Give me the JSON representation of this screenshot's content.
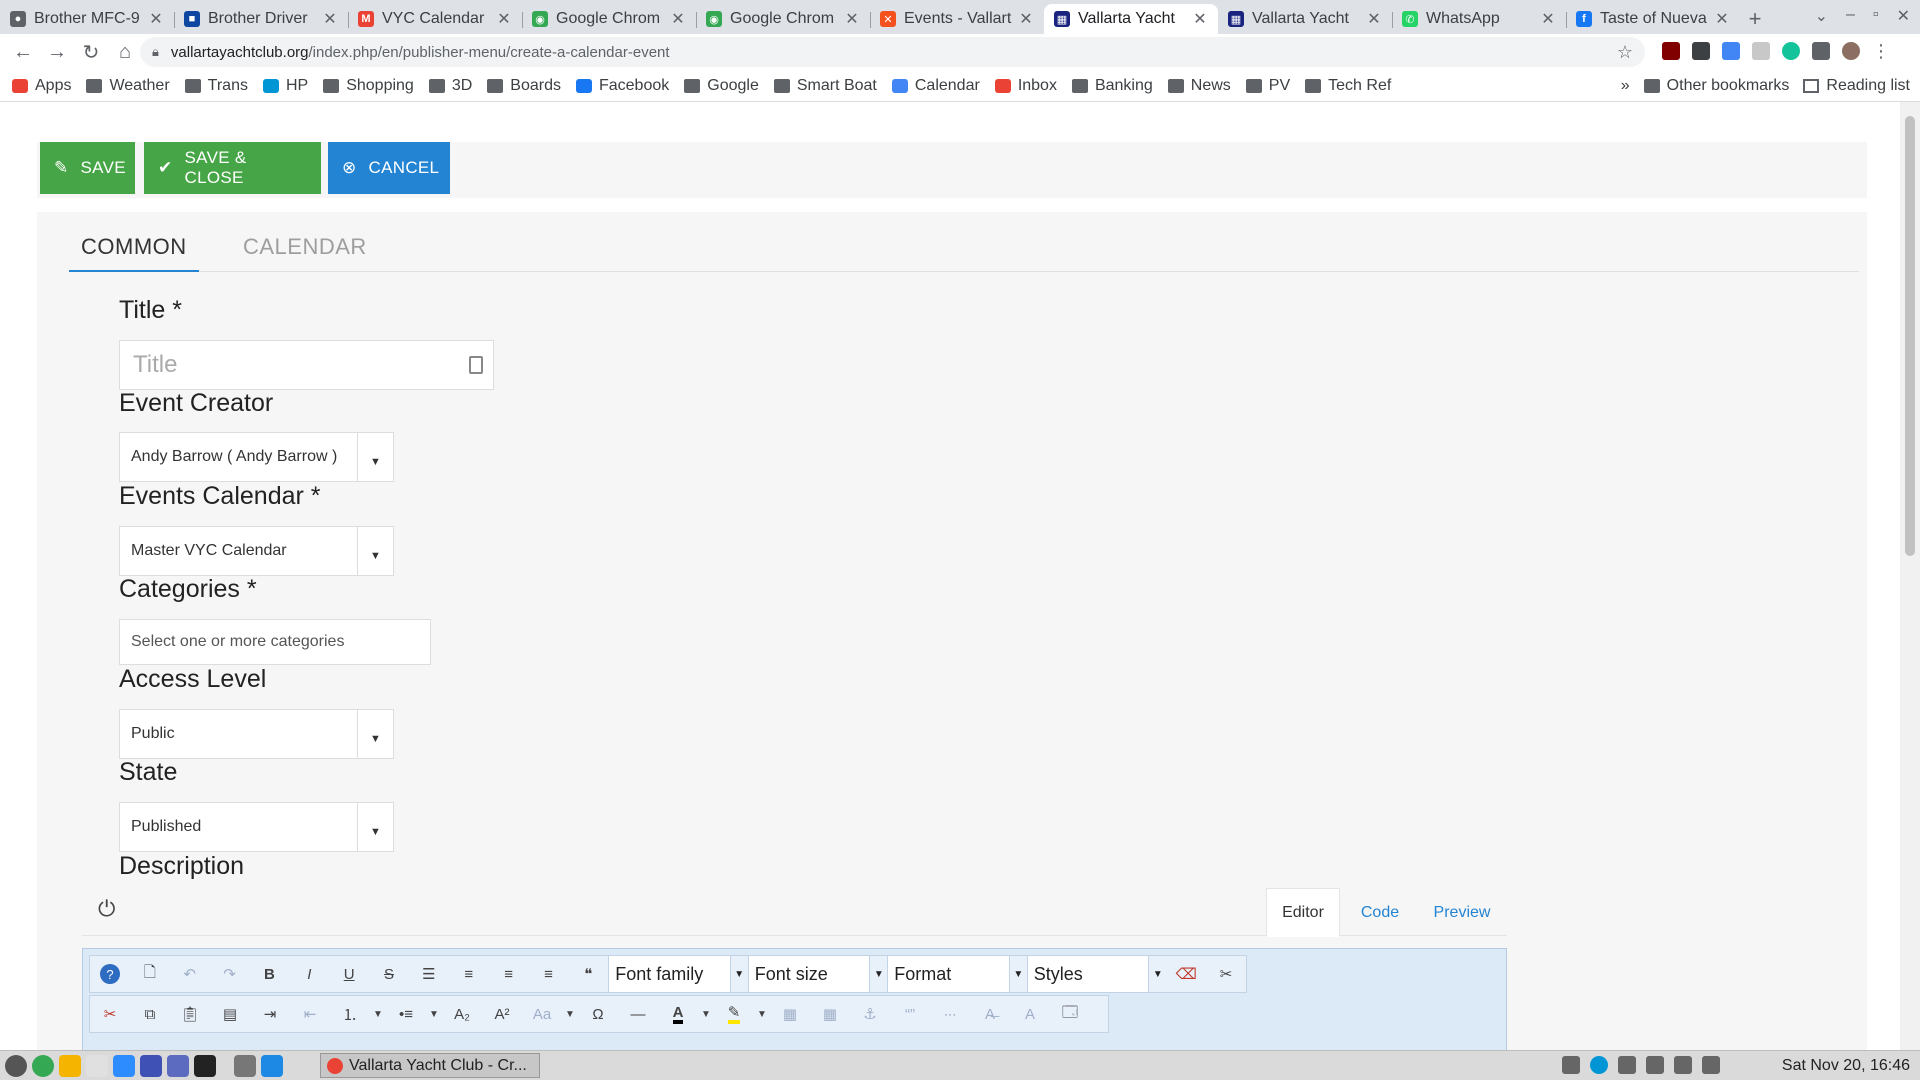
{
  "browser": {
    "tabs": [
      {
        "label": "Brother MFC-9",
        "fav_color": "#5f6368",
        "fav_glyph": "●"
      },
      {
        "label": "Brother Driver",
        "fav_color": "#0d47a1",
        "fav_glyph": "■"
      },
      {
        "label": "VYC Calendar",
        "fav_color": "#ea4335",
        "fav_glyph": "M"
      },
      {
        "label": "Google Chrom",
        "fav_color": "#34a853",
        "fav_glyph": "◉"
      },
      {
        "label": "Google Chrom",
        "fav_color": "#34a853",
        "fav_glyph": "◉"
      },
      {
        "label": "Events - Vallart",
        "fav_color": "#f4511e",
        "fav_glyph": "✕"
      },
      {
        "label": "Vallarta Yacht",
        "fav_color": "#1a237e",
        "fav_glyph": "▦"
      },
      {
        "label": "Vallarta Yacht",
        "fav_color": "#1a237e",
        "fav_glyph": "▦"
      },
      {
        "label": "WhatsApp",
        "fav_color": "#25d366",
        "fav_glyph": "✆"
      },
      {
        "label": "Taste of Nueva",
        "fav_color": "#1877f2",
        "fav_glyph": "f"
      }
    ],
    "active_tab_index": 6,
    "tab_close": "✕",
    "new_tab": "+",
    "url_domain": "vallartayachtclub.org",
    "url_path": "/index.php/en/publisher-menu/create-a-calendar-event",
    "bookmarks": [
      {
        "label": "Apps",
        "icon": "apps-grid-icon",
        "color": "#ea4335"
      },
      {
        "label": "Weather",
        "icon": "folder-icon",
        "color": "#5f6368"
      },
      {
        "label": "Trans",
        "icon": "folder-icon",
        "color": "#5f6368"
      },
      {
        "label": "HP",
        "icon": "hp-icon",
        "color": "#0096d6"
      },
      {
        "label": "Shopping",
        "icon": "folder-icon",
        "color": "#5f6368"
      },
      {
        "label": "3D",
        "icon": "folder-icon",
        "color": "#5f6368"
      },
      {
        "label": "Boards",
        "icon": "folder-icon",
        "color": "#5f6368"
      },
      {
        "label": "Facebook",
        "icon": "facebook-icon",
        "color": "#1877f2"
      },
      {
        "label": "Google",
        "icon": "folder-icon",
        "color": "#5f6368"
      },
      {
        "label": "Smart Boat",
        "icon": "folder-icon",
        "color": "#5f6368"
      },
      {
        "label": "Calendar",
        "icon": "calendar-icon",
        "color": "#4285f4"
      },
      {
        "label": "Inbox",
        "icon": "gmail-icon",
        "color": "#ea4335"
      },
      {
        "label": "Banking",
        "icon": "folder-icon",
        "color": "#5f6368"
      },
      {
        "label": "News",
        "icon": "folder-icon",
        "color": "#5f6368"
      },
      {
        "label": "PV",
        "icon": "folder-icon",
        "color": "#5f6368"
      },
      {
        "label": "Tech Ref",
        "icon": "folder-icon",
        "color": "#5f6368"
      }
    ],
    "bookmarks_overflow": "»",
    "other_bookmarks": "Other bookmarks",
    "reading_list": "Reading list"
  },
  "actions": {
    "save": "SAVE",
    "save_close": "SAVE & CLOSE",
    "cancel": "CANCEL",
    "save_color": "#46a546",
    "cancel_color": "#2384d3"
  },
  "form_tabs": {
    "common": "COMMON",
    "calendar": "CALENDAR"
  },
  "fields": {
    "title_label": "Title *",
    "title_placeholder": "Title",
    "creator_label": "Event Creator",
    "creator_value": "Andy Barrow ( Andy Barrow )",
    "calendar_label": "Events Calendar *",
    "calendar_value": "Master VYC Calendar",
    "categories_label": "Categories *",
    "categories_placeholder": "Select one or more categories",
    "access_label": "Access Level",
    "access_value": "Public",
    "state_label": "State",
    "state_value": "Published",
    "description_label": "Description"
  },
  "editor": {
    "tabs": {
      "editor": "Editor",
      "code": "Code",
      "preview": "Preview"
    },
    "font_family": "Font family",
    "font_size": "Font size",
    "format": "Format",
    "styles": "Styles"
  },
  "taskbar": {
    "window_title": "Vallarta Yacht Club - Cr...",
    "clock": "Sat Nov 20, 16:46"
  }
}
